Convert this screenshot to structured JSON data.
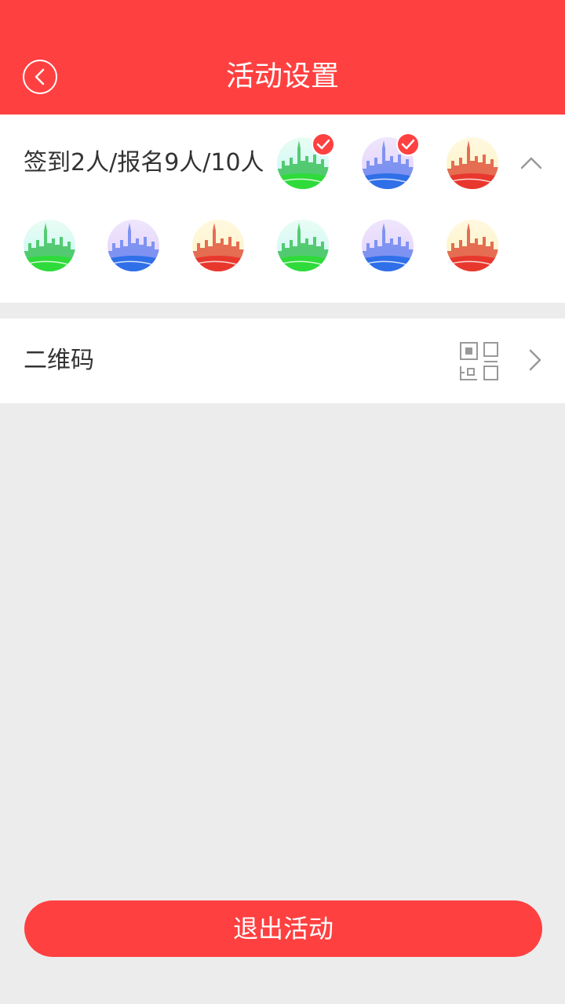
{
  "header": {
    "title": "活动设置",
    "back_icon": "back-circle-icon"
  },
  "members": {
    "summary": "签到2人/报名9人/10人",
    "collapse_icon": "chevron-up-icon",
    "row1": [
      {
        "name": "avatar-1",
        "theme": "green",
        "checked": true
      },
      {
        "name": "avatar-2",
        "theme": "blue",
        "checked": true
      },
      {
        "name": "avatar-3",
        "theme": "red",
        "checked": false
      }
    ],
    "row2": [
      {
        "name": "avatar-4",
        "theme": "green"
      },
      {
        "name": "avatar-5",
        "theme": "blue"
      },
      {
        "name": "avatar-6",
        "theme": "red"
      },
      {
        "name": "avatar-7",
        "theme": "green"
      },
      {
        "name": "avatar-8",
        "theme": "blue"
      },
      {
        "name": "avatar-9",
        "theme": "red"
      }
    ]
  },
  "qr": {
    "label": "二维码",
    "icon": "qr-code-icon",
    "chevron_icon": "chevron-right-icon"
  },
  "footer": {
    "exit_label": "退出活动"
  },
  "colors": {
    "accent": "#ff4040",
    "background": "#ececec",
    "text": "#333333"
  }
}
